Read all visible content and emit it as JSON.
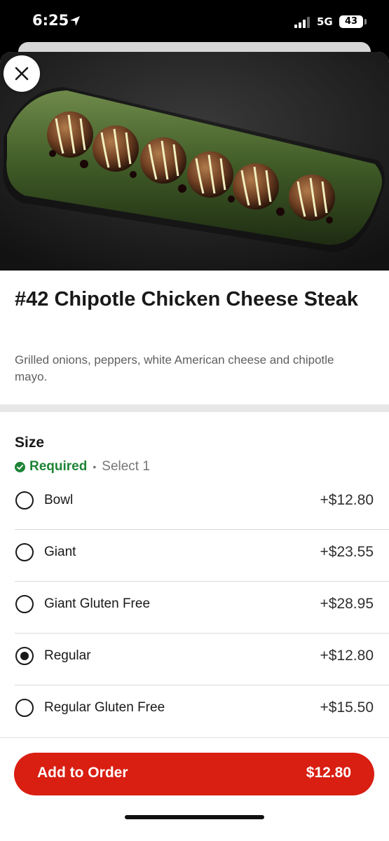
{
  "status_bar": {
    "time": "6:25",
    "network": "5G",
    "battery": "43"
  },
  "item": {
    "title": "#42 Chipotle Chicken Cheese Steak",
    "description": "Grilled onions, peppers, white American cheese and chipotle mayo."
  },
  "size_section": {
    "title": "Size",
    "required_label": "Required",
    "separator": "•",
    "select_text": "Select 1",
    "options": [
      {
        "label": "Bowl",
        "price": "+$12.80",
        "selected": false
      },
      {
        "label": "Giant",
        "price": "+$23.55",
        "selected": false
      },
      {
        "label": "Giant Gluten Free",
        "price": "+$28.95",
        "selected": false
      },
      {
        "label": "Regular",
        "price": "+$12.80",
        "selected": true
      },
      {
        "label": "Regular Gluten Free",
        "price": "+$15.50",
        "selected": false
      }
    ]
  },
  "footer": {
    "add_label": "Add to Order",
    "total": "$12.80"
  },
  "colors": {
    "accent": "#d91e12",
    "required_green": "#1f8436"
  },
  "icons": {
    "close": "close-icon",
    "required": "check-circle-icon",
    "location": "location-arrow-icon"
  }
}
